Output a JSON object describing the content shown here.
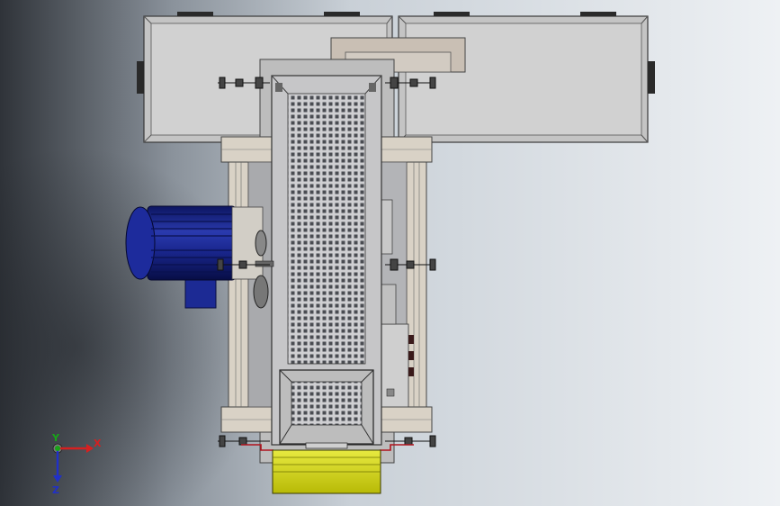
{
  "viewport": {
    "name": "3d-model-viewport",
    "background": {
      "left": "#2e3238",
      "right": "#eef1f4"
    }
  },
  "model": {
    "frame_color": "#d9d2c6",
    "hopper_color": "#d4d4d4",
    "motor_color": "#1a2a8c",
    "chute_color": "#d2d40a",
    "pipe_color": "#b0141e"
  },
  "triad": {
    "x_label": "X",
    "y_label": "Y",
    "z_label": "Z",
    "x_color": "#d62020",
    "y_color": "#18a418",
    "z_color": "#2030c8"
  }
}
